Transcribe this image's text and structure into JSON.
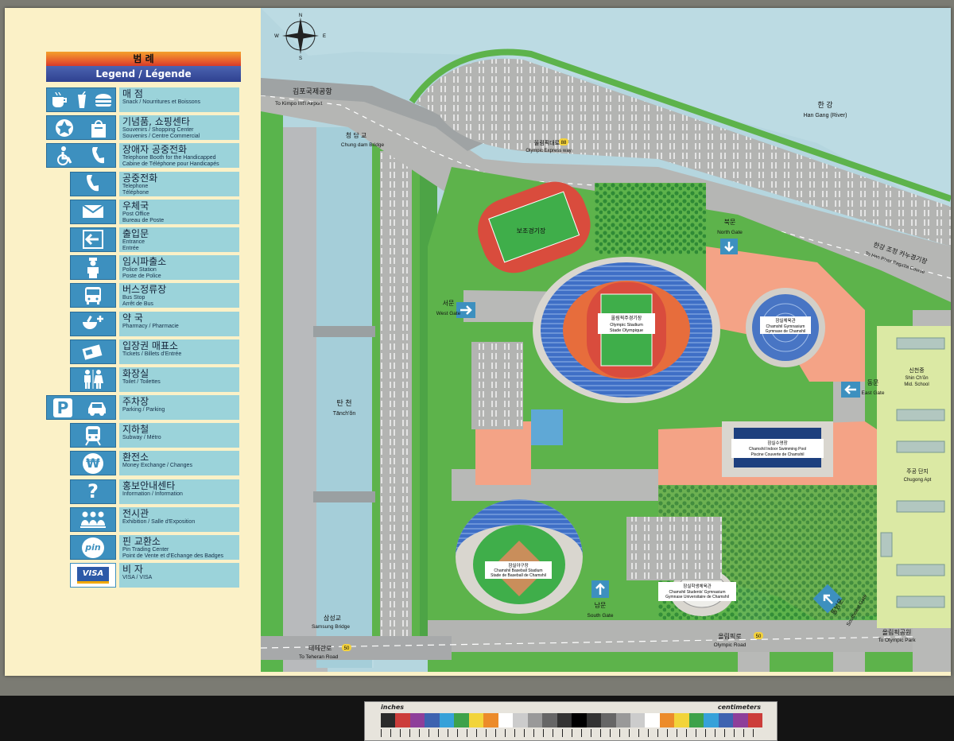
{
  "legend": {
    "title_ko": "범  례",
    "title_en": "Legend / Légende",
    "items": [
      {
        "ko": "매  점",
        "en1": "Snack / Nourritures et Boissons",
        "en2": "",
        "icon": "snack-icon"
      },
      {
        "ko": "기념품, 쇼핑센타",
        "en1": "Souvenirs / Shopping Center",
        "en2": "Souvenirs / Centre Commercial",
        "icon": "souvenir-icon"
      },
      {
        "ko": "장애자 공중전화",
        "en1": "Telephone Booth for the Handicapped",
        "en2": "Cabine de Téléphone pour Handicapés",
        "icon": "handicapped-phone-icon"
      },
      {
        "ko": "공중전화",
        "en1": "Telephone",
        "en2": "Téléphone",
        "icon": "telephone-icon"
      },
      {
        "ko": "우체국",
        "en1": "Post Office",
        "en2": "Bureau de Poste",
        "icon": "post-office-icon"
      },
      {
        "ko": "출입문",
        "en1": "Entrance",
        "en2": "Entrée",
        "icon": "entrance-icon"
      },
      {
        "ko": "임시파출소",
        "en1": "Police Station",
        "en2": "Poste de Police",
        "icon": "police-icon"
      },
      {
        "ko": "버스정류장",
        "en1": "Bus Stop",
        "en2": "Arrêt de Bus",
        "icon": "bus-icon"
      },
      {
        "ko": "약  국",
        "en1": "Pharmacy / Pharmacie",
        "en2": "",
        "icon": "pharmacy-icon"
      },
      {
        "ko": "입장권 매표소",
        "en1": "Tickets / Billets d'Entrée",
        "en2": "",
        "icon": "ticket-icon"
      },
      {
        "ko": "화장실",
        "en1": "Toilet / Toilettes",
        "en2": "",
        "icon": "toilet-icon"
      },
      {
        "ko": "주차장",
        "en1": "Parking / Parking",
        "en2": "",
        "icon": "parking-icon"
      },
      {
        "ko": "지하철",
        "en1": "Subway / Métro",
        "en2": "",
        "icon": "subway-icon"
      },
      {
        "ko": "환전소",
        "en1": "Money Exchange / Changes",
        "en2": "",
        "icon": "money-exchange-icon"
      },
      {
        "ko": "홍보안내센타",
        "en1": "Information / Information",
        "en2": "",
        "icon": "information-icon"
      },
      {
        "ko": "전시관",
        "en1": "Exhibition / Salle d'Exposition",
        "en2": "",
        "icon": "exhibition-icon"
      },
      {
        "ko": "핀 교환소",
        "en1": "Pin Trading Center",
        "en2": "Point de Vente et d'Echange des Badges",
        "icon": "pin-icon"
      },
      {
        "ko": "비  자",
        "en1": "VISA / VISA",
        "en2": "",
        "icon": "visa-icon"
      }
    ],
    "pin_text": "pin",
    "visa_text": "VISA",
    "p_text": "P",
    "won_text": "₩",
    "q_text": "?",
    "arrow_text": "←"
  },
  "map": {
    "compass": {
      "n": "N",
      "s": "S",
      "e": "E",
      "w": "W"
    },
    "river_ko": "한       강",
    "river_en": "Han Gang (River)",
    "airport_ko": "김포국제공항",
    "airport_en": "To Kimpo Int'l Airport",
    "chungdam_ko": "청  담  교",
    "chungdam_en": "Chung dam Bridge",
    "express_ko": "올림픽대로",
    "express_num": "88",
    "express_en": "Olympic Express way",
    "canoe_ko": "한강 조정 카누경기장",
    "canoe_en": "To Han River Regatta Course",
    "tanchon_ko": "탄  천",
    "tanchon_en": "Tānch'ŏn",
    "samsung_ko": "삼성교",
    "samsung_en": "Samsung Bridge",
    "teheran_ko": "테헤란로",
    "teheran_num": "50",
    "teheran_en": "To Teheran Road",
    "olympic_road_ko": "올림픽로",
    "olympic_road_num": "50",
    "olympic_road_en": "Olympic Road",
    "olympic_park_ko": "올림픽공원",
    "olympic_park_en": "To Olympic Park",
    "north_gate_ko": "북문",
    "north_gate_en": "North Gate",
    "west_gate_ko": "서문",
    "west_gate_en": "West Gate",
    "east_gate_ko": "동문",
    "east_gate_en": "East Gate",
    "south_gate_ko": "남문",
    "south_gate_en": "South Gate",
    "southeast_gate_ko": "동남문",
    "southeast_gate_en": "Southeast Gate",
    "warmup_ko": "보조경기장",
    "stadium_ko": "올림픽주경기장",
    "stadium_en1": "Olympic Stadium",
    "stadium_en2": "Stade Olympique",
    "gym_ko": "잠실체육관",
    "gym_en1": "Chamshil Gymnasium",
    "gym_en2": "Gymnase de Chamshil",
    "pool_ko": "잠실수영장",
    "pool_en1": "Chamshil Indoor Swimming Pool",
    "pool_en2": "Piscine Couverte de Chamshil",
    "baseball_ko": "잠실야구장",
    "baseball_en1": "Chamshil Baseball Stadium",
    "baseball_en2": "Stade de Baseball de Chamshil",
    "students_ko": "잠실학생체육관",
    "students_en1": "Chamshil Students' Gymnasium",
    "students_en2": "Gymnase Universitaire de Chamshil",
    "school_ko": "신천중",
    "school_en1": "Shin Ch'ŏn",
    "school_en2": "Mid. School",
    "apt_ko": "주공 단지",
    "apt_en": "Chugong Apt"
  },
  "scale_bar": {
    "inches": "inches",
    "centimeters": "centimeters"
  },
  "colors": {
    "water": "#bcdbe3",
    "road": "#b5b6b4",
    "grass": "#59b44c",
    "plaza": "#f4a386",
    "legend_blue": "#3d90bf",
    "legend_cyan": "#9bd3da"
  }
}
